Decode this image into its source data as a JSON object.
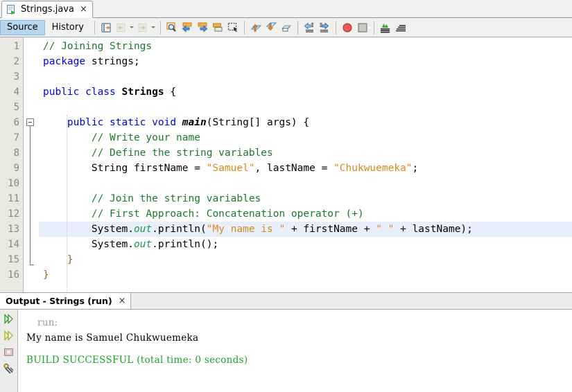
{
  "window": {
    "document_tab": {
      "title": "Strings.java",
      "icon": "java-file-icon",
      "close": "×"
    }
  },
  "toolbar": {
    "view_tabs": [
      {
        "label": "Source",
        "selected": true
      },
      {
        "label": "History",
        "selected": false
      }
    ],
    "buttons": [
      {
        "name": "last-edit-icon"
      },
      {
        "name": "back-icon"
      },
      {
        "name": "forward-icon"
      },
      {
        "name": "find-selection-icon"
      },
      {
        "name": "previous-bookmark-icon"
      },
      {
        "name": "next-bookmark-icon"
      },
      {
        "name": "toggle-bookmark-icon"
      },
      {
        "name": "toggle-rectangular-selection-icon"
      },
      {
        "name": "shift-line-up-icon"
      },
      {
        "name": "shift-line-down-icon"
      },
      {
        "name": "comment-icon"
      },
      {
        "name": "shift-line-left-icon"
      },
      {
        "name": "shift-line-right-icon"
      },
      {
        "name": "toggle-breakpoint-icon"
      },
      {
        "name": "stop-icon"
      },
      {
        "name": "inspect-members-icon"
      },
      {
        "name": "inspect-hierarchy-icon"
      }
    ]
  },
  "editor": {
    "line_numbers": [
      "1",
      "2",
      "3",
      "4",
      "5",
      "6",
      "7",
      "8",
      "9",
      "10",
      "11",
      "12",
      "13",
      "14",
      "15",
      "16"
    ],
    "highlighted_line": 13,
    "fold_start_line": 6,
    "fold_end_line": 15,
    "lines": [
      {
        "n": 1,
        "tokens": [
          {
            "t": "cmt",
            "v": "// Joining Strings"
          }
        ]
      },
      {
        "n": 2,
        "tokens": [
          {
            "t": "kw",
            "v": "package"
          },
          {
            "t": "pln",
            "v": " strings;"
          }
        ]
      },
      {
        "n": 3,
        "tokens": []
      },
      {
        "n": 4,
        "tokens": [
          {
            "t": "kw",
            "v": "public class "
          },
          {
            "t": "cls",
            "v": "Strings"
          },
          {
            "t": "pln",
            "v": " {"
          }
        ]
      },
      {
        "n": 5,
        "tokens": []
      },
      {
        "n": 6,
        "tokens": [
          {
            "t": "pln",
            "v": "    "
          },
          {
            "t": "kw",
            "v": "public static void "
          },
          {
            "t": "mth",
            "v": "main"
          },
          {
            "t": "pln",
            "v": "(String[] args) {"
          }
        ]
      },
      {
        "n": 7,
        "tokens": [
          {
            "t": "pln",
            "v": "        "
          },
          {
            "t": "cmt",
            "v": "// Write your name"
          }
        ]
      },
      {
        "n": 8,
        "tokens": [
          {
            "t": "pln",
            "v": "        "
          },
          {
            "t": "cmt",
            "v": "// Define the string variables"
          }
        ]
      },
      {
        "n": 9,
        "tokens": [
          {
            "t": "pln",
            "v": "        String firstName = "
          },
          {
            "t": "str",
            "v": "\"Samuel\""
          },
          {
            "t": "pln",
            "v": ", lastName = "
          },
          {
            "t": "str",
            "v": "\"Chukwuemeka\""
          },
          {
            "t": "pln",
            "v": ";"
          }
        ]
      },
      {
        "n": 10,
        "tokens": []
      },
      {
        "n": 11,
        "tokens": [
          {
            "t": "pln",
            "v": "        "
          },
          {
            "t": "cmt",
            "v": "// Join the string variables"
          }
        ]
      },
      {
        "n": 12,
        "tokens": [
          {
            "t": "pln",
            "v": "        "
          },
          {
            "t": "cmt",
            "v": "// First Approach: Concatenation operator (+)"
          }
        ]
      },
      {
        "n": 13,
        "tokens": [
          {
            "t": "pln",
            "v": "        System."
          },
          {
            "t": "fld",
            "v": "out"
          },
          {
            "t": "pln",
            "v": ".println("
          },
          {
            "t": "str",
            "v": "\"My name is \""
          },
          {
            "t": "pln",
            "v": " + firstName + "
          },
          {
            "t": "str",
            "v": "\" \""
          },
          {
            "t": "pln",
            "v": " + lastName);"
          }
        ]
      },
      {
        "n": 14,
        "tokens": [
          {
            "t": "pln",
            "v": "        System."
          },
          {
            "t": "fld",
            "v": "out"
          },
          {
            "t": "pln",
            "v": ".println();"
          }
        ]
      },
      {
        "n": 15,
        "tokens": [
          {
            "t": "pln",
            "v": "    "
          },
          {
            "t": "brc",
            "v": "}"
          }
        ]
      },
      {
        "n": 16,
        "tokens": [
          {
            "t": "brc",
            "v": "}"
          }
        ]
      }
    ]
  },
  "output": {
    "tab": {
      "title": "Output - Strings (run)",
      "close": "×"
    },
    "sidebar_buttons": [
      {
        "name": "rerun-icon"
      },
      {
        "name": "rerun-alt-icon"
      },
      {
        "name": "stop-process-icon"
      },
      {
        "name": "settings-wrench-icon"
      }
    ],
    "lines": [
      {
        "style": "dim",
        "text": "run:"
      },
      {
        "style": "plain",
        "text": "My name is Samuel Chukwuemeka"
      },
      {
        "style": "blank",
        "text": ""
      },
      {
        "style": "ok",
        "text": "BUILD SUCCESSFUL (total time: 0 seconds)"
      }
    ]
  },
  "colors": {
    "keyword": "#0000e6",
    "comment": "#1a7a2a",
    "string": "#d88b18",
    "field": "#1a9a4a",
    "highlight_row": "#e8eefa",
    "selected_tab": "#b8d6f0",
    "build_success": "#1aa22a"
  }
}
